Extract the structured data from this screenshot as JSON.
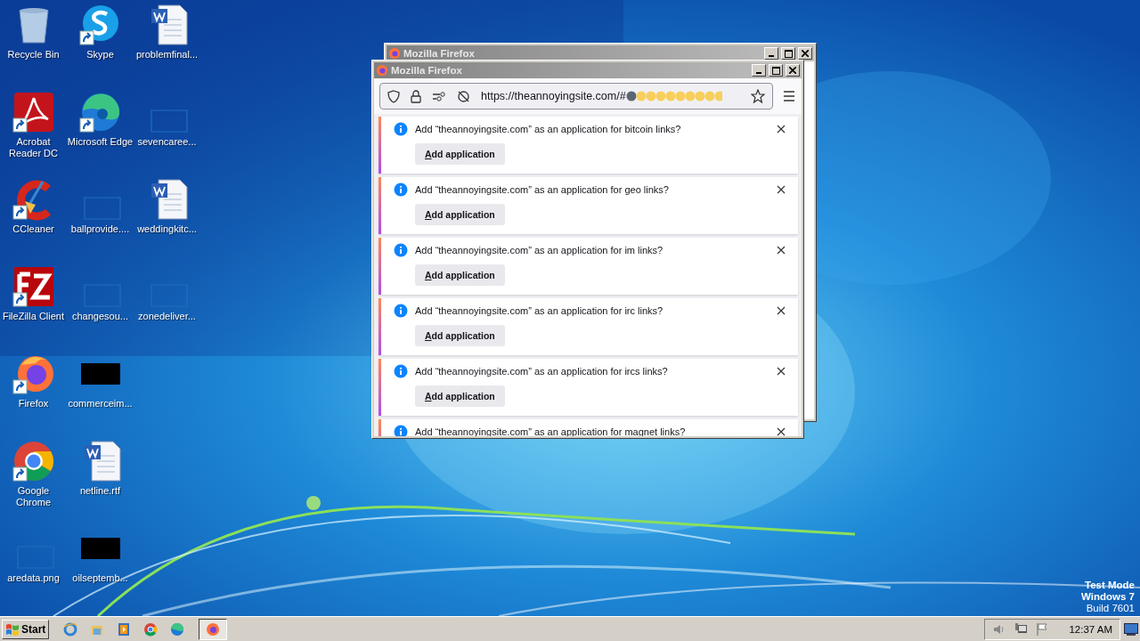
{
  "desktop": {
    "icons": [
      {
        "label": "Recycle Bin",
        "kind": "recycle",
        "shortcut": false
      },
      {
        "label": "Acrobat Reader DC",
        "kind": "acrobat",
        "shortcut": true
      },
      {
        "label": "CCleaner",
        "kind": "ccleaner",
        "shortcut": true
      },
      {
        "label": "FileZilla Client",
        "kind": "filezilla",
        "shortcut": true
      },
      {
        "label": "Firefox",
        "kind": "firefox",
        "shortcut": true
      },
      {
        "label": "Google Chrome",
        "kind": "chrome",
        "shortcut": true
      },
      {
        "label": "aredata.png",
        "kind": "blank",
        "shortcut": false
      },
      {
        "label": "Skype",
        "kind": "skype",
        "shortcut": true
      },
      {
        "label": "Microsoft Edge",
        "kind": "edge",
        "shortcut": true
      },
      {
        "label": "ballprovide....",
        "kind": "blank",
        "shortcut": false
      },
      {
        "label": "changesou...",
        "kind": "blank",
        "shortcut": false
      },
      {
        "label": "commerceim...",
        "kind": "black",
        "shortcut": false
      },
      {
        "label": "netline.rtf",
        "kind": "word",
        "shortcut": false
      },
      {
        "label": "oilseptemb...",
        "kind": "black",
        "shortcut": false
      },
      {
        "label": "problemfinal...",
        "kind": "word",
        "shortcut": false
      },
      {
        "label": "sevencaree...",
        "kind": "blank",
        "shortcut": false
      },
      {
        "label": "weddingkitc...",
        "kind": "word",
        "shortcut": false
      },
      {
        "label": "zonedeliver...",
        "kind": "blank",
        "shortcut": false
      }
    ],
    "system_text": [
      "Test Mode",
      "Windows 7",
      "Build 7601"
    ]
  },
  "windows": [
    {
      "title": "Mozilla Firefox"
    },
    {
      "title": "Mozilla Firefox",
      "url": "https://theannoyingsite.com/#",
      "notifications": [
        {
          "text": "Add “theannoyingsite.com” as an application for bitcoin links?",
          "button": "Add application"
        },
        {
          "text": "Add “theannoyingsite.com” as an application for geo links?",
          "button": "Add application"
        },
        {
          "text": "Add “theannoyingsite.com” as an application for im links?",
          "button": "Add application"
        },
        {
          "text": "Add “theannoyingsite.com” as an application for irc links?",
          "button": "Add application"
        },
        {
          "text": "Add “theannoyingsite.com” as an application for ircs links?",
          "button": "Add application"
        },
        {
          "text": "Add “theannoyingsite.com” as an application for magnet links?"
        }
      ]
    }
  ],
  "taskbar": {
    "start": "Start",
    "quick_launch": [
      {
        "kind": "ie"
      },
      {
        "kind": "explorer"
      },
      {
        "kind": "media"
      },
      {
        "kind": "chrome"
      },
      {
        "kind": "edge"
      }
    ],
    "tasks": [
      {
        "kind": "firefox",
        "selected": true
      }
    ],
    "clock": "12:37 AM"
  }
}
